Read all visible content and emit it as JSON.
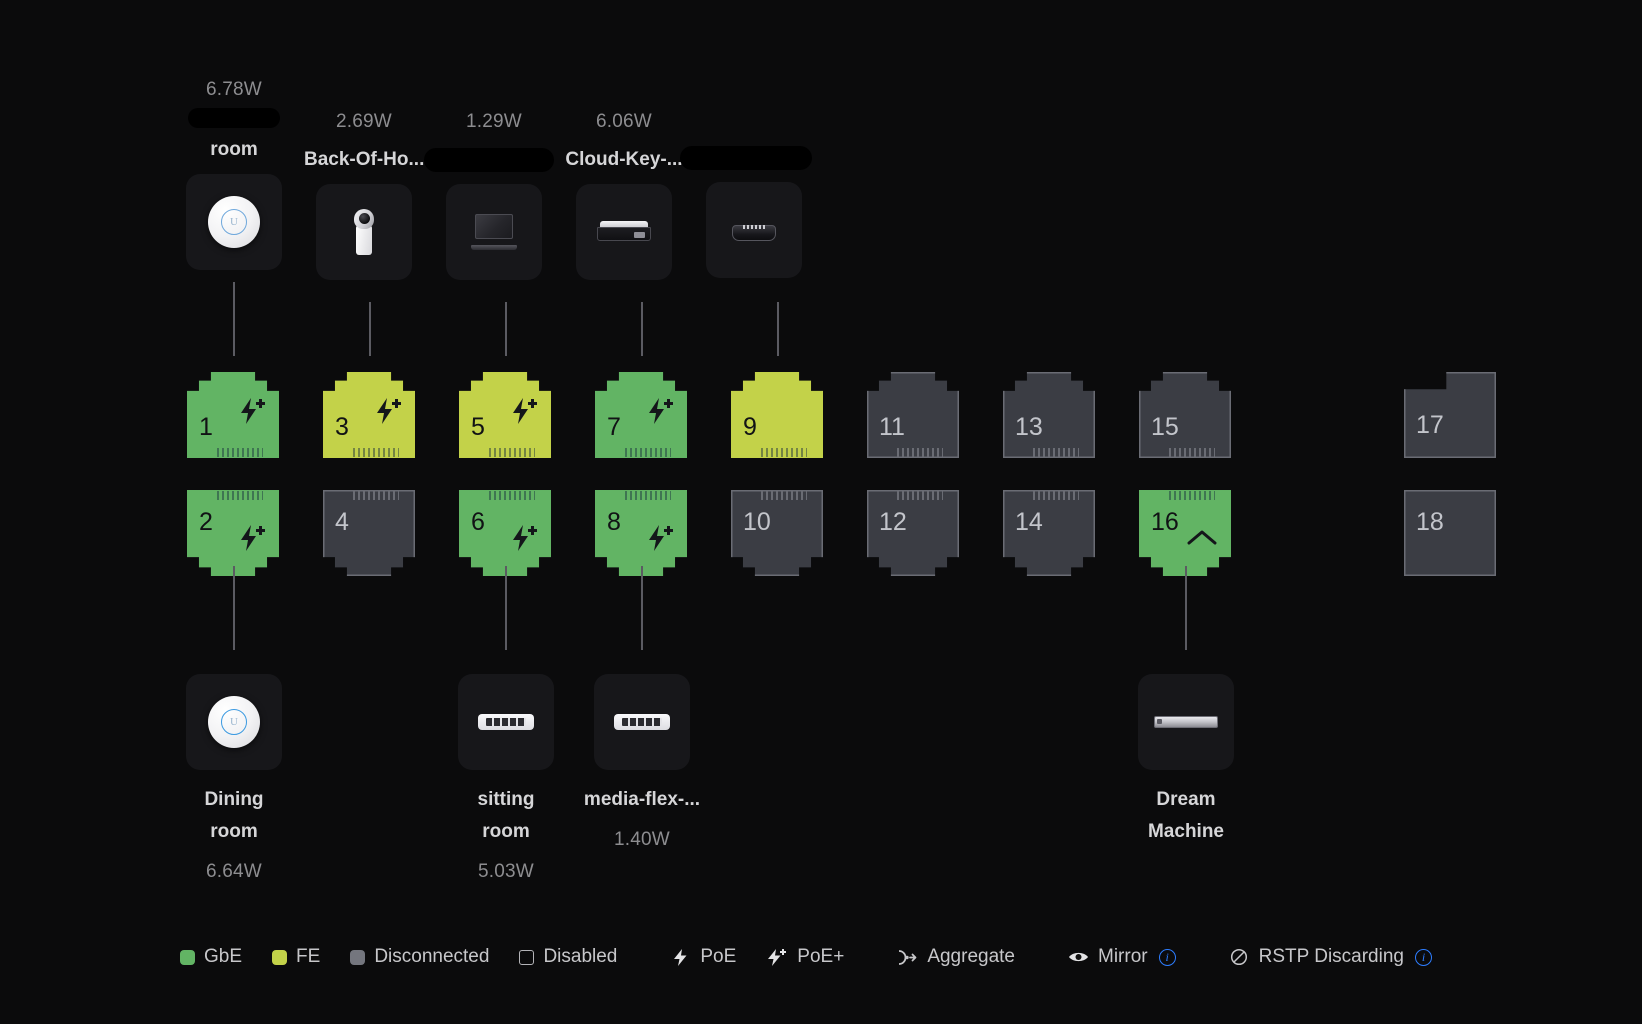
{
  "theme": {
    "bg": "#0b0b0c",
    "tile_bg": "#17171a",
    "gbe": "#62b464",
    "fe": "#c3d249",
    "disconnected": "#3b3d44",
    "disconnected_border": "#6a6c74",
    "link_line": "#5b5b62",
    "label": "#d6d6d8",
    "muted": "#8d8d90",
    "accent_blue": "#2d7dff"
  },
  "top_devices": [
    {
      "power": "6.78W",
      "name_line1": "",
      "name_line2": "room",
      "redacted": true,
      "icon": "unifi-ap-icon"
    },
    {
      "power": "2.69W",
      "name_line1": "Back-Of-Ho...",
      "name_line2": "",
      "redacted": false,
      "icon": "camera-icon"
    },
    {
      "power": "1.29W",
      "name_line1": "",
      "name_line2": "",
      "redacted": true,
      "icon": "laptop-icon"
    },
    {
      "power": "6.06W",
      "name_line1": "Cloud-Key-...",
      "name_line2": "",
      "redacted": false,
      "icon": "cloud-key-icon"
    },
    {
      "power": "",
      "name_line1": "",
      "name_line2": "",
      "redacted": true,
      "icon": "gateway-icon"
    }
  ],
  "ports_top": [
    {
      "num": "1",
      "state": "GbE",
      "badge": "poe-plus-icon",
      "type": "rj45"
    },
    {
      "num": "3",
      "state": "FE",
      "badge": "poe-plus-icon",
      "type": "rj45"
    },
    {
      "num": "5",
      "state": "FE",
      "badge": "poe-plus-icon",
      "type": "rj45"
    },
    {
      "num": "7",
      "state": "GbE",
      "badge": "poe-plus-icon",
      "type": "rj45"
    },
    {
      "num": "9",
      "state": "FE",
      "badge": "",
      "type": "rj45"
    },
    {
      "num": "11",
      "state": "Disconnected",
      "badge": "",
      "type": "rj45"
    },
    {
      "num": "13",
      "state": "Disconnected",
      "badge": "",
      "type": "rj45"
    },
    {
      "num": "15",
      "state": "Disconnected",
      "badge": "",
      "type": "rj45"
    },
    {
      "num": "17",
      "state": "Disconnected",
      "badge": "",
      "type": "sfp"
    }
  ],
  "ports_bottom": [
    {
      "num": "2",
      "state": "GbE",
      "badge": "poe-plus-icon",
      "type": "rj45"
    },
    {
      "num": "4",
      "state": "Disconnected",
      "badge": "",
      "type": "rj45"
    },
    {
      "num": "6",
      "state": "GbE",
      "badge": "poe-plus-icon",
      "type": "rj45"
    },
    {
      "num": "8",
      "state": "GbE",
      "badge": "poe-plus-icon",
      "type": "rj45"
    },
    {
      "num": "10",
      "state": "Disconnected",
      "badge": "",
      "type": "rj45"
    },
    {
      "num": "12",
      "state": "Disconnected",
      "badge": "",
      "type": "rj45"
    },
    {
      "num": "14",
      "state": "Disconnected",
      "badge": "",
      "type": "rj45"
    },
    {
      "num": "16",
      "state": "GbE",
      "badge": "chevron-up-icon",
      "type": "rj45"
    },
    {
      "num": "18",
      "state": "Disconnected",
      "badge": "",
      "type": "sfp-plain"
    }
  ],
  "bottom_devices": [
    {
      "name_line1": "Dining",
      "name_line2": "room",
      "power": "6.64W",
      "icon": "unifi-ap-icon"
    },
    {
      "name_line1": "sitting",
      "name_line2": "room",
      "power": "5.03W",
      "icon": "flex-switch-icon"
    },
    {
      "name_line1": "media-flex-...",
      "name_line2": "",
      "power": "1.40W",
      "icon": "flex-switch-icon"
    },
    {
      "name_line1": "Dream",
      "name_line2": "Machine",
      "power": "",
      "icon": "dream-machine-icon"
    }
  ],
  "legend": [
    {
      "label": "GbE",
      "kind": "swatch",
      "color": "#62b464",
      "info": false
    },
    {
      "label": "FE",
      "kind": "swatch",
      "color": "#c3d249",
      "info": false
    },
    {
      "label": "Disconnected",
      "kind": "swatch",
      "color": "#74767e",
      "info": false
    },
    {
      "label": "Disabled",
      "kind": "hollow",
      "color": "",
      "info": false
    },
    {
      "label": "PoE",
      "kind": "icon",
      "icon": "poe-icon",
      "info": false
    },
    {
      "label": "PoE+",
      "kind": "icon",
      "icon": "poe-plus-icon",
      "info": false
    },
    {
      "label": "Aggregate",
      "kind": "icon",
      "icon": "aggregate-icon",
      "info": false
    },
    {
      "label": "Mirror",
      "kind": "icon",
      "icon": "mirror-icon",
      "info": true
    },
    {
      "label": "RSTP Discarding",
      "kind": "icon",
      "icon": "rstp-icon",
      "info": true
    }
  ]
}
